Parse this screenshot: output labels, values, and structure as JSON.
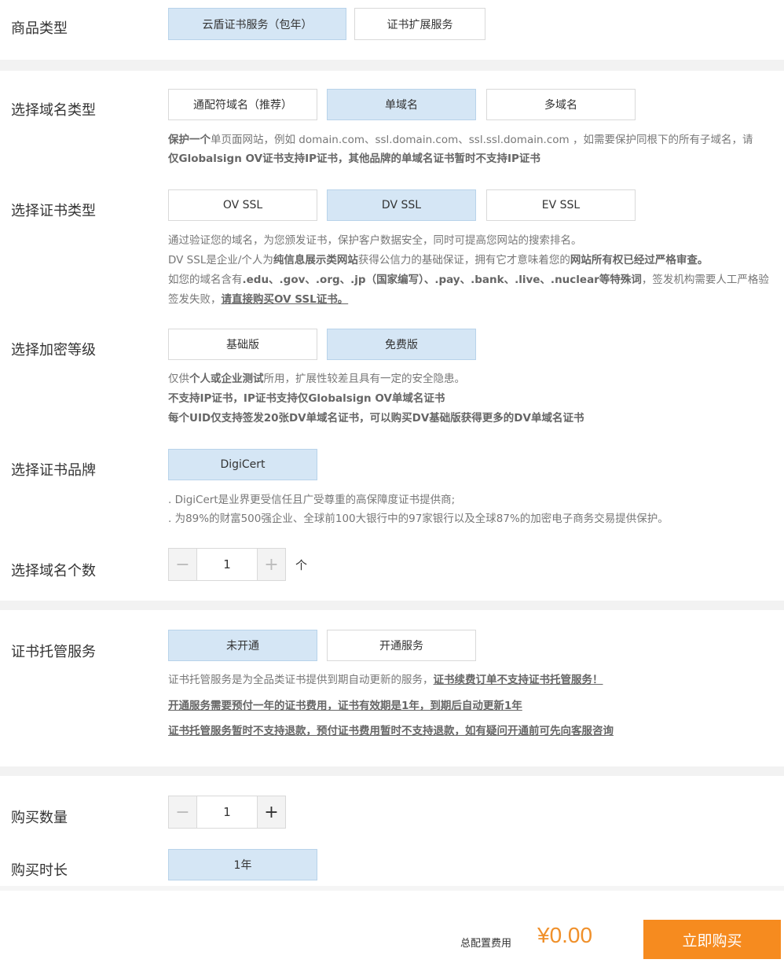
{
  "product_type": {
    "label": "商品类型",
    "options": [
      "云盾证书服务（包年）",
      "证书扩展服务"
    ]
  },
  "domain_type": {
    "label": "选择域名类型",
    "options": [
      "通配符域名（推荐）",
      "单域名",
      "多域名"
    ],
    "desc_line1_b": "保护一个",
    "desc_line1_rest": "单页面网站，例如 domain.com、ssl.domain.com、ssl.ssl.domain.com ，如需要保护同根下的所有子域名，请",
    "desc_line2": "仅Globalsign OV证书支持IP证书，其他品牌的单域名证书暂时不支持IP证书"
  },
  "cert_type": {
    "label": "选择证书类型",
    "options": [
      "OV SSL",
      "DV SSL",
      "EV SSL"
    ],
    "desc_line1": "通过验证您的域名，为您颁发证书，保护客户数据安全，同时可提高您网站的搜索排名。",
    "desc_line2_a": "DV SSL是企业/个人为",
    "desc_line2_b": "纯信息展示类网站",
    "desc_line2_c": "获得公信力的基础保证，拥有它才意味着您的",
    "desc_line2_d": "网站所有权已经过严格审查。",
    "desc_line3_a": "如您的域名含有",
    "desc_line3_b": ".edu、.gov、.org、.jp（国家编写）、.pay、.bank、.live、.nuclear等特殊词",
    "desc_line3_c": "，签发机构需要人工严格验",
    "desc_line4_a": "签发失败，",
    "desc_line4_b": "请直接购买OV SSL证书。"
  },
  "encryption": {
    "label": "选择加密等级",
    "options": [
      "基础版",
      "免费版"
    ],
    "desc_line1_a": "仅供",
    "desc_line1_b": "个人或企业测试",
    "desc_line1_c": "所用，扩展性较差且具有一定的安全隐患。",
    "desc_line2": "不支持IP证书，IP证书支持仅Globalsign OV单域名证书",
    "desc_line3": "每个UID仅支持签发20张DV单域名证书，可以购买DV基础版获得更多的DV单域名证书"
  },
  "brand": {
    "label": "选择证书品牌",
    "options": [
      "DigiCert"
    ],
    "desc_line1": ". DigiCert是业界更受信任且广受尊重的高保障度证书提供商;",
    "desc_line2": ". 为89%的财富500强企业、全球前100大银行中的97家银行以及全球87%的加密电子商务交易提供保护。"
  },
  "domain_count": {
    "label": "选择域名个数",
    "value": "1",
    "minus": "−",
    "plus": "+",
    "unit": "个"
  },
  "hosting": {
    "label": "证书托管服务",
    "options": [
      "未开通",
      "开通服务"
    ],
    "desc_line1_a": "证书托管服务是为全品类证书提供到期自动更新的服务，",
    "desc_line1_b": "证书续费订单不支持证书托管服务！",
    "desc_line2": "开通服务需要预付一年的证书费用，证书有效期是1年，到期后自动更新1年",
    "desc_line3": "证书托管服务暂时不支持退款，预付证书费用暂时不支持退款，如有疑问开通前可先向客服咨询"
  },
  "quantity": {
    "label": "购买数量",
    "value": "1",
    "minus": "−",
    "plus": "+"
  },
  "duration": {
    "label": "购买时长",
    "options": [
      "1年"
    ]
  },
  "footer": {
    "price_label": "总配置费用",
    "price": "¥0.00",
    "buy_label": "立即购买"
  },
  "colors": {
    "selected_bg": "#d5e6f5",
    "accent": "#f68b1f",
    "price": "#f0902a"
  }
}
